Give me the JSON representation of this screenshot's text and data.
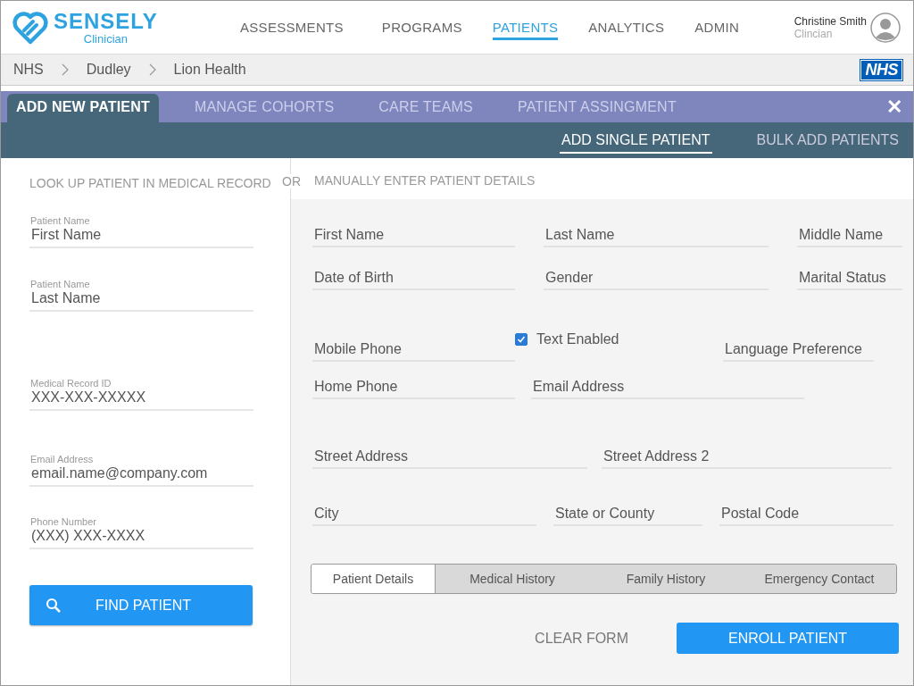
{
  "header": {
    "logo": {
      "name": "SENSELY",
      "subtitle": "Clinician"
    },
    "nav": [
      {
        "label": "ASSESSMENTS",
        "selected": false
      },
      {
        "label": "PROGRAMS",
        "selected": false
      },
      {
        "label": "PATIENTS",
        "selected": true
      },
      {
        "label": "ANALYTICS",
        "selected": false
      },
      {
        "label": "ADMIN",
        "selected": false
      }
    ],
    "user": {
      "name": "Christine Smith",
      "role": "Clincian"
    }
  },
  "breadcrumb": {
    "items": [
      "NHS",
      "Dudley",
      "Lion Health"
    ],
    "badge": "NHS"
  },
  "tabs": [
    {
      "label": "ADD NEW PATIENT",
      "selected": true
    },
    {
      "label": "MANAGE COHORTS",
      "selected": false
    },
    {
      "label": "CARE TEAMS",
      "selected": false
    },
    {
      "label": "PATIENT ASSINGMENT",
      "selected": false
    }
  ],
  "close": "✕",
  "subtabs": [
    {
      "label": "ADD SINGLE PATIENT",
      "selected": true
    },
    {
      "label": "BULK ADD PATIENTS",
      "selected": false
    }
  ],
  "lookup": {
    "heading": "LOOK UP PATIENT IN MEDICAL RECORD",
    "fields": [
      {
        "label": "Patient Name",
        "placeholder": "First Name"
      },
      {
        "label": "Patient Name",
        "placeholder": "Last Name"
      },
      {
        "label": "Medical Record ID",
        "placeholder": "XXX-XXX-XXXXX"
      },
      {
        "label": "Email Address",
        "placeholder": "email.name@company.com"
      },
      {
        "label": "Phone Number",
        "placeholder": "(XXX) XXX-XXXX"
      }
    ],
    "button": "FIND PATIENT"
  },
  "separator": "OR",
  "manual": {
    "heading": "MANUALLY ENTER PATIENT DETAILS",
    "rows": [
      [
        {
          "kind": "field",
          "placeholder": "First Name"
        },
        {
          "kind": "field",
          "placeholder": "Last Name"
        },
        {
          "kind": "field",
          "placeholder": "Middle Name"
        }
      ],
      [
        {
          "kind": "field",
          "placeholder": "Date of Birth"
        },
        {
          "kind": "field",
          "placeholder": "Gender"
        },
        {
          "kind": "field",
          "placeholder": "Marital Status"
        }
      ],
      [
        {
          "kind": "field",
          "placeholder": "Mobile Phone"
        },
        {
          "kind": "checkbox",
          "label": "Text Enabled",
          "checked": true
        },
        {
          "kind": "field",
          "placeholder": "Language Preference"
        }
      ],
      [
        {
          "kind": "field",
          "placeholder": "Home Phone"
        },
        {
          "kind": "field",
          "placeholder": "Email Address"
        }
      ],
      [
        {
          "kind": "field",
          "placeholder": "Street Address"
        },
        {
          "kind": "field",
          "placeholder": "Street Address 2"
        }
      ],
      [
        {
          "kind": "field",
          "placeholder": "City"
        },
        {
          "kind": "field",
          "placeholder": "State or County"
        },
        {
          "kind": "field",
          "placeholder": "Postal Code"
        }
      ]
    ],
    "section_tabs": [
      {
        "label": "Patient Details",
        "selected": true
      },
      {
        "label": "Medical History",
        "selected": false
      },
      {
        "label": "Family History",
        "selected": false
      },
      {
        "label": "Emergency Contact",
        "selected": false
      }
    ],
    "clear": "CLEAR FORM",
    "enroll": "ENROLL PATIENT"
  }
}
